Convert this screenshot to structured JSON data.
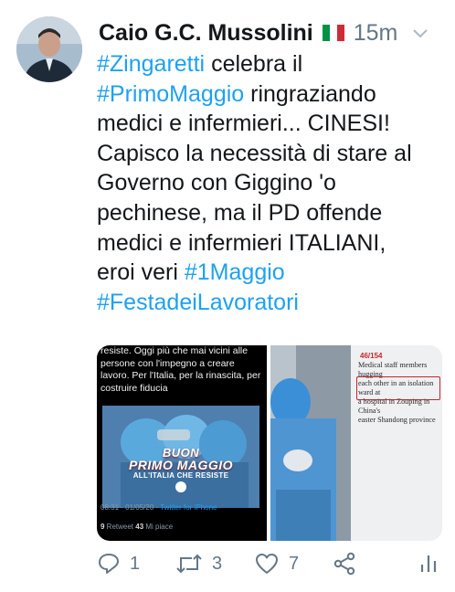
{
  "tweet": {
    "author_name": "Caio G.C. Mussolini",
    "flag_icon": "italy-flag-icon",
    "timestamp": "15m",
    "text_lines": [
      [
        {
          "t": "#Zingaretti",
          "h": true
        },
        {
          "t": " celebra il",
          "h": false
        }
      ],
      [
        {
          "t": "#PrimoMaggio",
          "h": true
        },
        {
          "t": " ringraziando",
          "h": false
        }
      ],
      [
        {
          "t": "medici e infermieri... CINESI!",
          "h": false
        }
      ],
      [
        {
          "t": "Capisco la necessità di stare al",
          "h": false
        }
      ],
      [
        {
          "t": "Governo con Giggino 'o",
          "h": false
        }
      ],
      [
        {
          "t": "pechinese, ma il PD offende",
          "h": false
        }
      ],
      [
        {
          "t": "medici e infermieri ITALIANI,",
          "h": false
        }
      ],
      [
        {
          "t": "eroi veri ",
          "h": false
        },
        {
          "t": "#1Maggio",
          "h": true
        }
      ],
      [
        {
          "t": "#FestadeiLavoratori",
          "h": true
        }
      ]
    ],
    "media": {
      "left": {
        "post_text": [
          "resiste. Oggi più che mai vicini alle",
          "persone con l'impegno a creare",
          "lavoro. Per l'Italia, per la rinascita, per",
          "costruire fiducia"
        ],
        "banner": {
          "line1": "BUON",
          "line2": "PRIMO MAGGIO",
          "line3": "ALL'ITALIA CHE RESISTE"
        },
        "meta_time": "08:31 · 01/05/20 · ",
        "meta_source": "Twitter for iPhone",
        "retweets_count": "9",
        "retweets_label": " Retweet ",
        "likes_count": "43",
        "likes_label": " Mi piace"
      },
      "right": {
        "counter": "46/154",
        "news_text": [
          "Medical staff members hugging",
          "each other in an isolation ward at",
          "a hospital in Zouping in China's",
          "easter Shandong province"
        ]
      }
    },
    "actions": {
      "reply_count": "1",
      "retweet_count": "3",
      "like_count": "7"
    },
    "colors": {
      "hashtag": "#1da1f2",
      "secondary_text": "#657786",
      "highlight_box": "#c62828"
    }
  }
}
